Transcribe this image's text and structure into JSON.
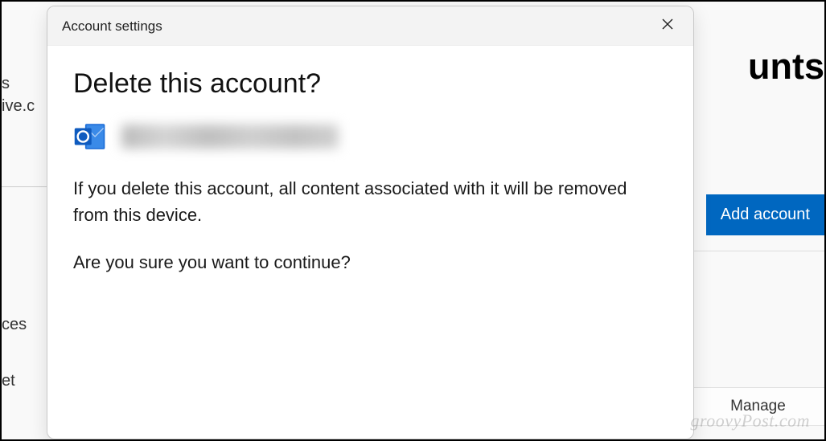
{
  "background": {
    "header_fragment": "unts",
    "sidebar": {
      "frag1": "s",
      "frag2": "ive.c",
      "frag3": "ces",
      "frag4": "et"
    },
    "add_account_label": "Add account",
    "manage_label": "Manage"
  },
  "modal": {
    "title": "Account settings",
    "heading": "Delete this account?",
    "warning_text": "If you delete this account, all content associated with it will be removed from this device.",
    "confirm_text": "Are you sure you want to continue?"
  },
  "watermark": "groovyPost.com"
}
